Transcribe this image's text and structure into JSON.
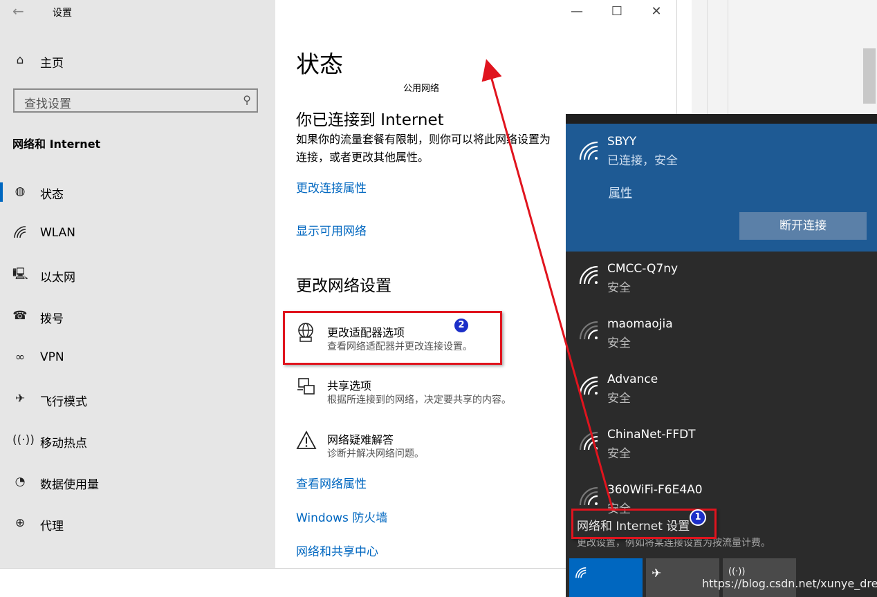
{
  "window": {
    "title": "设置",
    "minimize": "—",
    "maximize": "☐",
    "close": "✕"
  },
  "sidebar": {
    "home": "主页",
    "search_placeholder": "查找设置",
    "section_title": "网络和 Internet",
    "items": [
      {
        "label": "状态",
        "icon": "globe-icon",
        "selected": true
      },
      {
        "label": "WLAN",
        "icon": "wifi-icon"
      },
      {
        "label": "以太网",
        "icon": "ethernet-icon"
      },
      {
        "label": "拨号",
        "icon": "dialup-icon"
      },
      {
        "label": "VPN",
        "icon": "vpn-icon"
      },
      {
        "label": "飞行模式",
        "icon": "airplane-icon"
      },
      {
        "label": "移动热点",
        "icon": "hotspot-icon"
      },
      {
        "label": "数据使用量",
        "icon": "data-usage-icon"
      },
      {
        "label": "代理",
        "icon": "proxy-icon"
      }
    ]
  },
  "main": {
    "title": "状态",
    "public_network": "公用网络",
    "connected_heading": "你已连接到 Internet",
    "connected_text": "如果你的流量套餐有限制，则你可以将此网络设置为按流量计费的连接，或者更改其他属性。",
    "connected_text_line1": "如果你的流量套餐有限制，则你可以将此网络设置为",
    "connected_text_line2": "连接，或者更改其他属性。",
    "link_change_props": "更改连接属性",
    "link_show_networks": "显示可用网络",
    "change_heading": "更改网络设置",
    "options": [
      {
        "title": "更改适配器选项",
        "sub": "查看网络适配器并更改连接设置。",
        "icon": "adapter-icon"
      },
      {
        "title": "共享选项",
        "sub": "根据所连接到的网络，决定要共享的内容。",
        "icon": "sharing-icon"
      },
      {
        "title": "网络疑难解答",
        "sub": "诊断并解决网络问题。",
        "icon": "warning-icon"
      }
    ],
    "link_view_props": "查看网络属性",
    "link_firewall": "Windows 防火墙",
    "link_center": "网络和共享中心"
  },
  "flyout": {
    "connected": {
      "ssid": "SBYY",
      "status": "已连接，安全",
      "properties": "属性",
      "disconnect": "断开连接"
    },
    "networks": [
      {
        "ssid": "CMCC-Q7ny",
        "status": "安全"
      },
      {
        "ssid": "maomaojia",
        "status": "安全"
      },
      {
        "ssid": "Advance",
        "status": "安全"
      },
      {
        "ssid": "ChinaNet-FFDT",
        "status": "安全"
      },
      {
        "ssid": "360WiFi-F6E4A0",
        "status": "安全"
      }
    ],
    "settings_link": "网络和 Internet 设置",
    "settings_sub": "更改设置，例如将某连接设置为按流量计费。"
  },
  "annotations": {
    "badge1": "1",
    "badge2": "2",
    "accent": "#e0141e"
  },
  "watermark": "https://blog.csdn.net/xunye_dream",
  "colors": {
    "accent": "#0067c0",
    "flyout_selected": "#1e5a94",
    "flyout_bg": "#2b2b2b"
  }
}
